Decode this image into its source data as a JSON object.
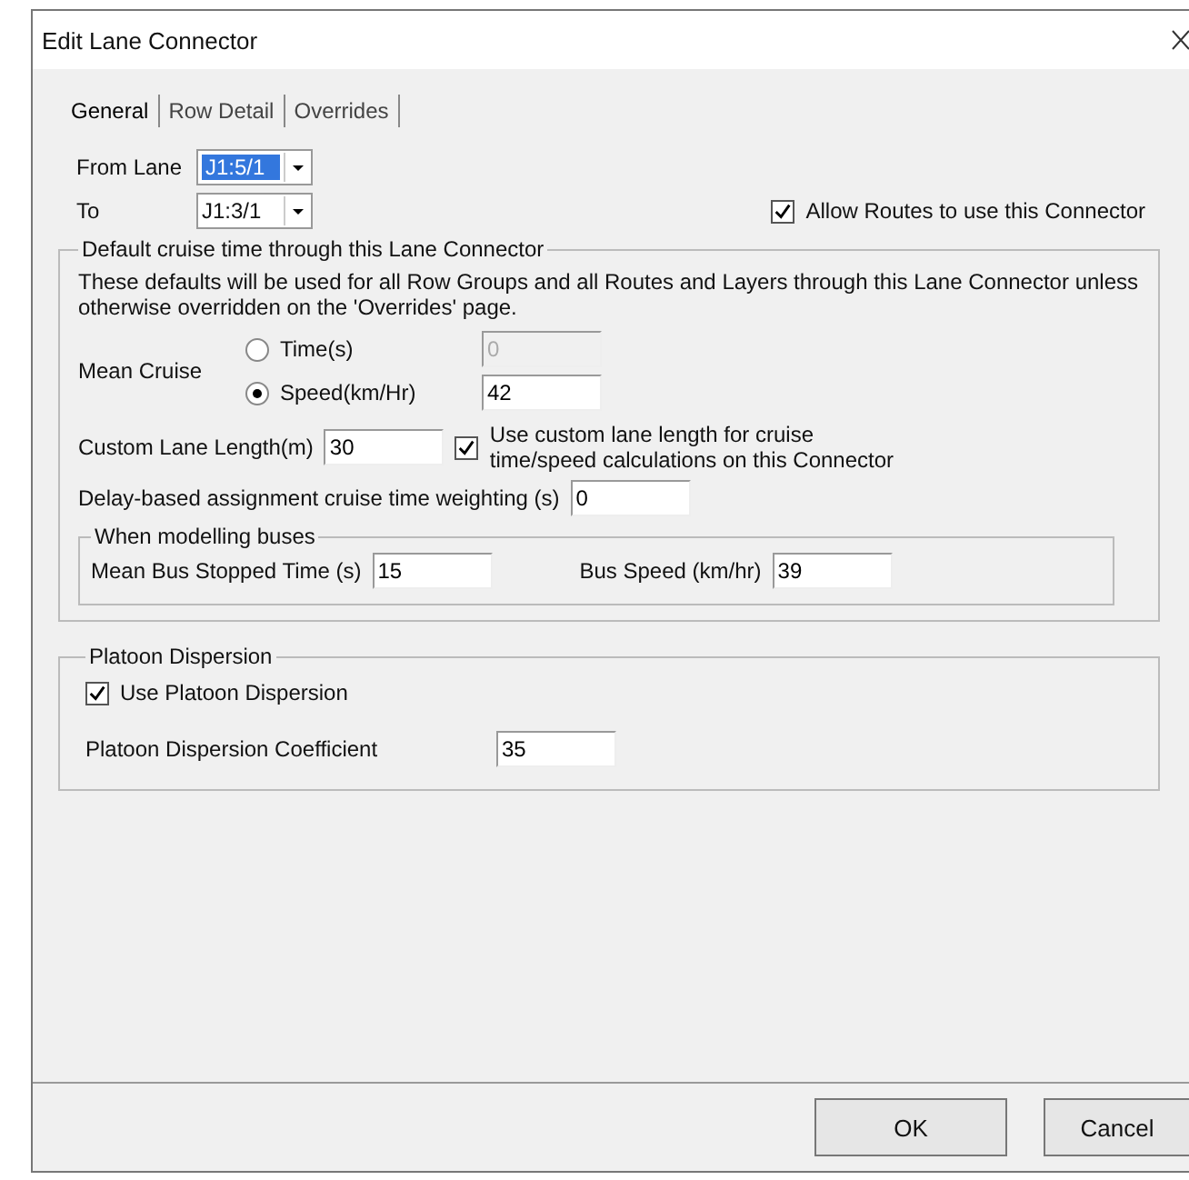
{
  "window": {
    "title": "Edit Lane Connector"
  },
  "tabs": [
    {
      "label": "General",
      "selected": true
    },
    {
      "label": "Row Detail",
      "selected": false
    },
    {
      "label": "Overrides",
      "selected": false
    }
  ],
  "from_lane": {
    "label": "From Lane",
    "value": "J1:5/1",
    "selected": true
  },
  "to_lane": {
    "label": "To",
    "value": "J1:3/1",
    "selected": false
  },
  "allow_routes": {
    "label": "Allow Routes to use this Connector",
    "checked": true
  },
  "cruise_group": {
    "title": "Default cruise time through this Lane Connector",
    "description": "These defaults will be used for all Row Groups and all Routes and Layers through this Lane Connector unless otherwise overridden on the 'Overrides' page.",
    "mean_cruise_label": "Mean Cruise",
    "options": [
      {
        "label": "Time(s)",
        "selected": false,
        "value": "0",
        "disabled": true
      },
      {
        "label": "Speed(km/Hr)",
        "selected": true,
        "value": "42",
        "disabled": false
      }
    ],
    "custom_length": {
      "label": "Custom Lane Length(m)",
      "value": "30",
      "checked": true,
      "checkbox_label": "Use custom lane length for cruise time/speed calculations on this Connector"
    },
    "delay_weighting": {
      "label": "Delay-based assignment cruise time weighting (s)",
      "value": "0"
    },
    "buses": {
      "title": "When modelling buses",
      "stopped_label": "Mean Bus Stopped Time (s)",
      "stopped_value": "15",
      "speed_label": "Bus Speed (km/hr)",
      "speed_value": "39"
    }
  },
  "platoon": {
    "title": "Platoon Dispersion",
    "use_label": "Use Platoon Dispersion",
    "checked": true,
    "coefficient_label": "Platoon Dispersion Coefficient",
    "coefficient_value": "35"
  },
  "buttons": [
    "OK",
    "Cancel"
  ]
}
